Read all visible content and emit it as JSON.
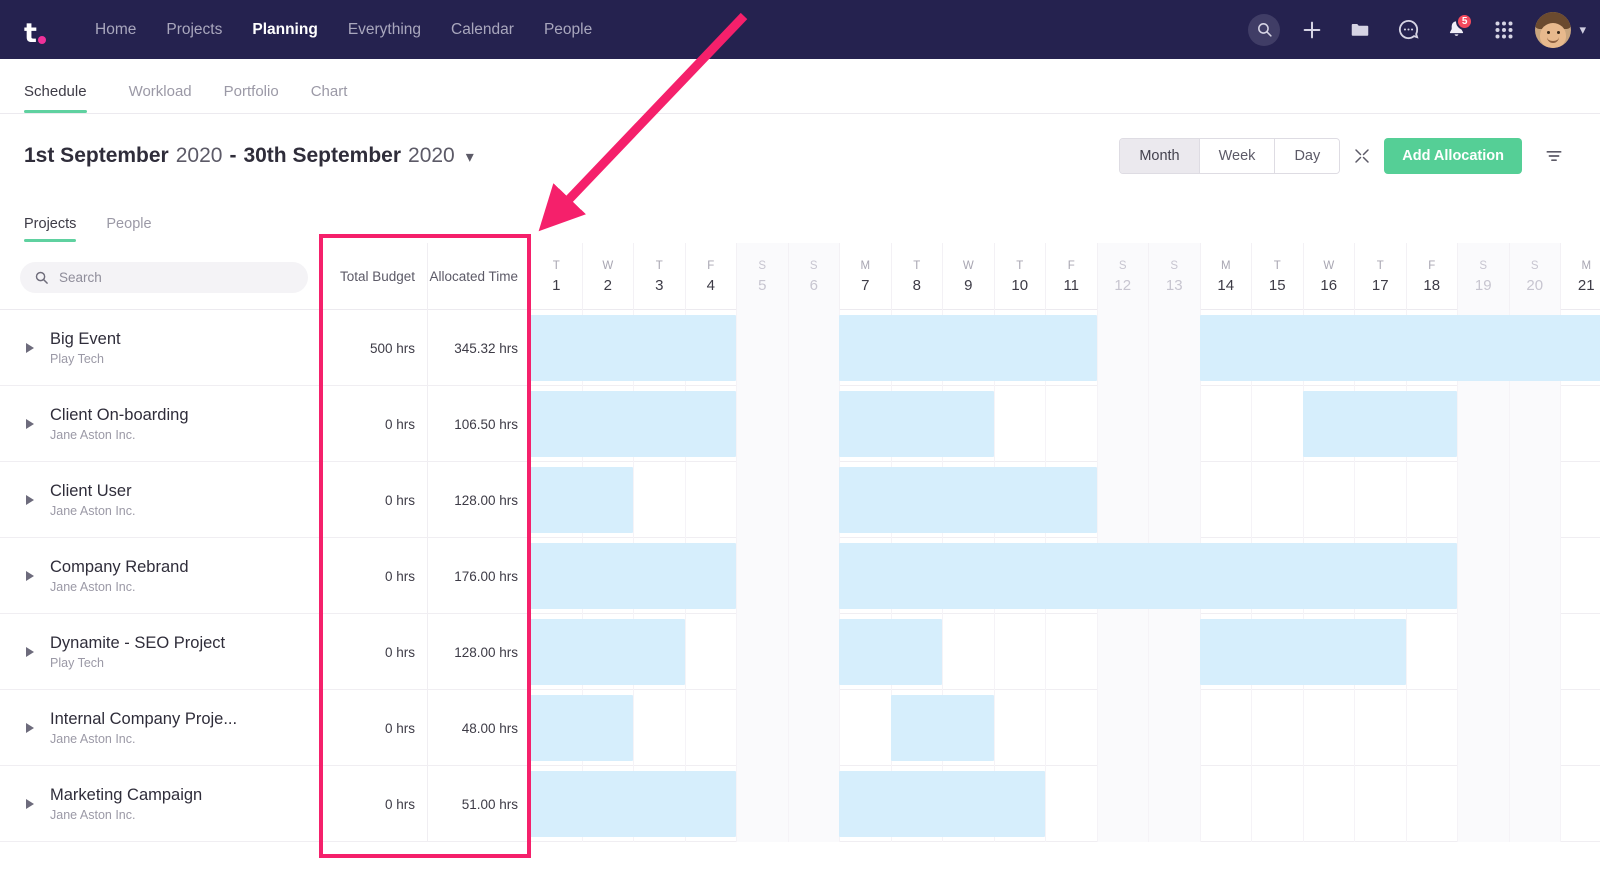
{
  "topnav": {
    "logo_icon": "teamwork-logo-icon",
    "items": [
      {
        "label": "Home",
        "active": false
      },
      {
        "label": "Projects",
        "active": false
      },
      {
        "label": "Planning",
        "active": true
      },
      {
        "label": "Everything",
        "active": false
      },
      {
        "label": "Calendar",
        "active": false
      },
      {
        "label": "People",
        "active": false
      }
    ],
    "icons": [
      "search-icon",
      "plus-icon",
      "folder-icon",
      "chat-icon",
      "bell-icon",
      "grid-icon"
    ],
    "notification_count": "5",
    "accent_pink": "#f0319a",
    "bar_color": "#25224f"
  },
  "subtabs": [
    {
      "label": "Schedule",
      "active": true
    },
    {
      "label": "Workload",
      "active": false
    },
    {
      "label": "Portfolio",
      "active": false
    },
    {
      "label": "Chart",
      "active": false
    }
  ],
  "daterange": {
    "start_day": "1st September",
    "start_year": "2020",
    "separator": "-",
    "end_day": "30th September",
    "end_year": "2020",
    "chevron": "chevron-down-icon"
  },
  "controls": {
    "zoom_levels": [
      {
        "label": "Month",
        "active": true
      },
      {
        "label": "Week",
        "active": false
      },
      {
        "label": "Day",
        "active": false
      }
    ],
    "expand_icon": "expand-arrows-icon",
    "add_allocation_label": "Add Allocation",
    "add_allocation_color": "#55cf96",
    "filter_icon": "filter-icon"
  },
  "pptabs": [
    {
      "label": "Projects",
      "active": true
    },
    {
      "label": "People",
      "active": false
    }
  ],
  "search": {
    "placeholder": "Search",
    "value": "",
    "icon": "search-icon"
  },
  "columns": {
    "total_budget": "Total Budget",
    "allocated_time": "Allocated Time"
  },
  "calendar": {
    "days": [
      {
        "dow": "T",
        "num": "1",
        "weekend": false
      },
      {
        "dow": "W",
        "num": "2",
        "weekend": false
      },
      {
        "dow": "T",
        "num": "3",
        "weekend": false
      },
      {
        "dow": "F",
        "num": "4",
        "weekend": false
      },
      {
        "dow": "S",
        "num": "5",
        "weekend": true
      },
      {
        "dow": "S",
        "num": "6",
        "weekend": true
      },
      {
        "dow": "M",
        "num": "7",
        "weekend": false
      },
      {
        "dow": "T",
        "num": "8",
        "weekend": false
      },
      {
        "dow": "W",
        "num": "9",
        "weekend": false
      },
      {
        "dow": "T",
        "num": "10",
        "weekend": false
      },
      {
        "dow": "F",
        "num": "11",
        "weekend": false
      },
      {
        "dow": "S",
        "num": "12",
        "weekend": true
      },
      {
        "dow": "S",
        "num": "13",
        "weekend": true
      },
      {
        "dow": "M",
        "num": "14",
        "weekend": false
      },
      {
        "dow": "T",
        "num": "15",
        "weekend": false
      },
      {
        "dow": "W",
        "num": "16",
        "weekend": false
      },
      {
        "dow": "T",
        "num": "17",
        "weekend": false
      },
      {
        "dow": "F",
        "num": "18",
        "weekend": false
      },
      {
        "dow": "S",
        "num": "19",
        "weekend": true
      },
      {
        "dow": "S",
        "num": "20",
        "weekend": true
      },
      {
        "dow": "M",
        "num": "21",
        "weekend": false
      }
    ]
  },
  "rows": [
    {
      "name": "Big Event",
      "client": "Play Tech",
      "total_budget": "500 hrs",
      "allocated_time": "345.32 hrs",
      "bars": [
        {
          "start": 0,
          "span": 4
        },
        {
          "start": 6,
          "span": 5
        },
        {
          "start": 13,
          "span": 8
        }
      ]
    },
    {
      "name": "Client On-boarding",
      "client": "Jane Aston Inc.",
      "total_budget": "0 hrs",
      "allocated_time": "106.50 hrs",
      "bars": [
        {
          "start": 0,
          "span": 4
        },
        {
          "start": 6,
          "span": 3
        },
        {
          "start": 15,
          "span": 3
        }
      ]
    },
    {
      "name": "Client User",
      "client": "Jane Aston Inc.",
      "total_budget": "0 hrs",
      "allocated_time": "128.00 hrs",
      "bars": [
        {
          "start": 0,
          "span": 2
        },
        {
          "start": 6,
          "span": 5
        }
      ]
    },
    {
      "name": "Company Rebrand",
      "client": "Jane Aston Inc.",
      "total_budget": "0 hrs",
      "allocated_time": "176.00 hrs",
      "bars": [
        {
          "start": 0,
          "span": 4
        },
        {
          "start": 6,
          "span": 12
        }
      ]
    },
    {
      "name": "Dynamite - SEO Project",
      "client": "Play Tech",
      "total_budget": "0 hrs",
      "allocated_time": "128.00 hrs",
      "bars": [
        {
          "start": 0,
          "span": 3
        },
        {
          "start": 6,
          "span": 2
        },
        {
          "start": 13,
          "span": 4
        }
      ]
    },
    {
      "name": "Internal Company Proje...",
      "client": "Jane Aston Inc.",
      "total_budget": "0 hrs",
      "allocated_time": "48.00 hrs",
      "bars": [
        {
          "start": 0,
          "span": 2
        },
        {
          "start": 7,
          "span": 2
        }
      ]
    },
    {
      "name": "Marketing Campaign",
      "client": "Jane Aston Inc.",
      "total_budget": "0 hrs",
      "allocated_time": "51.00 hrs",
      "bars": [
        {
          "start": 0,
          "span": 4
        },
        {
          "start": 6,
          "span": 4
        }
      ]
    }
  ],
  "annotation": {
    "color": "#f5206b",
    "highlight_target": "budget-and-allocated-time-columns",
    "arrow": "arrow-pointing-down-left"
  }
}
